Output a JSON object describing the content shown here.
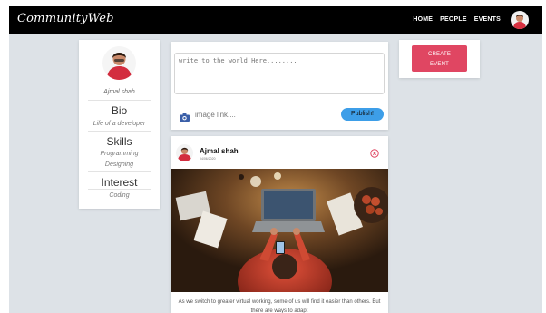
{
  "navbar": {
    "brand": "CommunityWeb",
    "links": [
      "HOME",
      "PEOPLE",
      "EVENTS"
    ],
    "background": "#000000"
  },
  "profile": {
    "name": "Ajmal shah",
    "sections": [
      {
        "title": "Bio",
        "items": [
          "Life of a developer"
        ]
      },
      {
        "title": "Skills",
        "items": [
          "Programming",
          "Designing"
        ]
      },
      {
        "title": "Interest",
        "items": [
          "Coding"
        ]
      }
    ]
  },
  "composer": {
    "placeholder": "write to the world Here........",
    "image_placeholder": "image link....",
    "publish_label": "Publish!",
    "icon": "camera-icon"
  },
  "post": {
    "author": "Ajmal shah",
    "date": "04/06/2020",
    "caption": "As we switch to greater virtual working, some of us will find it easier than others. But there are ways to adapt",
    "close_icon": "close-circle-icon"
  },
  "event": {
    "create_label_1": "CREATE",
    "create_label_2": "EVENT"
  },
  "colors": {
    "page_background": "#dde2e7",
    "accent_red": "#e04662",
    "publish_blue": "#3d9ee8"
  }
}
